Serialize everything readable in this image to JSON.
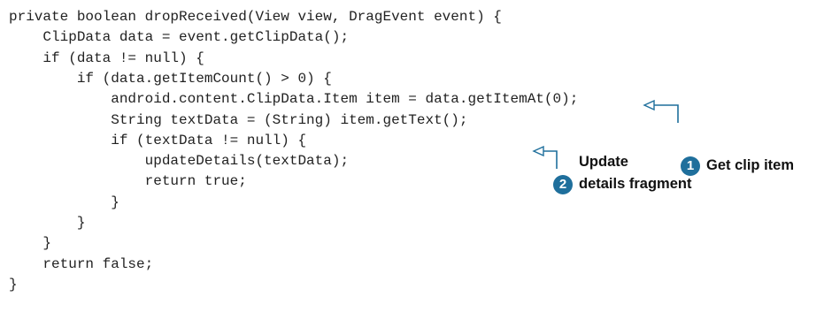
{
  "code": {
    "lines": [
      "private boolean dropReceived(View view, DragEvent event) {",
      "    ClipData data = event.getClipData();",
      "    if (data != null) {",
      "        if (data.getItemCount() > 0) {",
      "            android.content.ClipData.Item item = data.getItemAt(0);",
      "            String textData = (String) item.getText();",
      "            if (textData != null) {",
      "                updateDetails(textData);",
      "                return true;",
      "            }",
      "        }",
      "    }",
      "    return false;",
      "}"
    ]
  },
  "annotations": [
    {
      "number": "1",
      "text": "Get clip item"
    },
    {
      "number": "2",
      "line1": "Update",
      "line2": "details fragment"
    }
  ],
  "colors": {
    "badge": "#1f6f9c",
    "arrow": "#1f6f9c"
  },
  "icons": [
    "arrow-icon",
    "number-badge"
  ]
}
